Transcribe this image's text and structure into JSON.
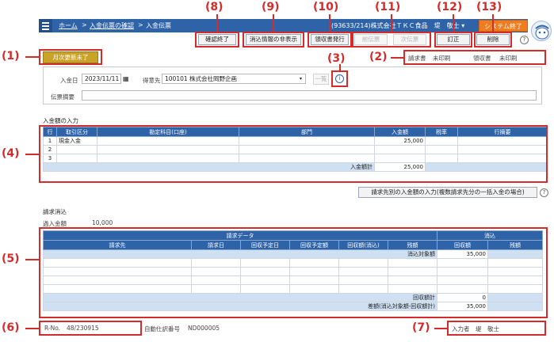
{
  "nav": {
    "breadcrumb_home": "ホーム",
    "breadcrumb_sep1": ">",
    "breadcrumb_confirm": "入金伝票の確認",
    "breadcrumb_sep2": ">",
    "breadcrumb_current": "入金伝票",
    "company": "(93633/214)株式会社ＴＫＣ食品　堤　敬士 ▾",
    "system_exit": "システム終了"
  },
  "toolbar": {
    "confirm_done": "確認終了",
    "hide_reconcile": "消込情報の非表示",
    "issue_receipt": "領収書発行",
    "prev_slip": "前伝票",
    "next_slip": "次伝票",
    "correct": "訂正",
    "delete": "削除"
  },
  "status": {
    "monthly_update": "月次更新未了",
    "invoice_label": "請求書",
    "invoice_status": "未印刷",
    "receipt_label": "領収書",
    "receipt_status": "未印刷"
  },
  "header_form": {
    "date_label": "入金日",
    "date_value": "2023/11/11",
    "customer_label": "得意先",
    "customer_value": "100101 株式会社岡野企画",
    "list_button": "一覧",
    "summary_label": "伝票摘要",
    "summary_value": ""
  },
  "deposit_section": {
    "title": "入金額の入力",
    "columns": [
      "行",
      "取引区分",
      "勘定科目(口座)",
      "部門",
      "入金額",
      "税率",
      "行摘要"
    ],
    "rows": [
      [
        "1",
        "現金入金",
        "",
        "",
        "25,000",
        "",
        ""
      ],
      [
        "2",
        "",
        "",
        "",
        "",
        "",
        ""
      ],
      [
        "3",
        "",
        "",
        "",
        "",
        "",
        ""
      ]
    ],
    "total_label": "入金額計",
    "total_value": "25,000"
  },
  "multi_customer_button": "請求先別の入金額の入力(複数請求先分の一括入金の場合)",
  "reconcile_section": {
    "title": "請求消込",
    "overpay_label": "過入金額",
    "overpay_value": "10,000",
    "group_invoice": "請求データ",
    "group_reconcile": "消込",
    "columns": [
      "請求先",
      "請求日",
      "回収予定日",
      "回収予定額",
      "回収額(消込)",
      "残額",
      "回収額",
      "残額"
    ],
    "target_label": "消込対象額",
    "target_value": "35,000",
    "collected_label": "回収額計",
    "collected_value": "0",
    "diff_label": "差額(消込対象額-回収額計)",
    "diff_value": "35,000"
  },
  "footer": {
    "rno_label": "R-No.",
    "rno_value": "48/230915",
    "auto_label": "自動仕訳番号",
    "auto_value": "ND000005",
    "inputter_label": "入力者",
    "inputter_value": "堤　敬士"
  },
  "callouts": {
    "c1": "(1)",
    "c2": "(2)",
    "c3": "(3)",
    "c4": "(4)",
    "c5": "(5)",
    "c6": "(6)",
    "c7": "(7)",
    "c8": "(8)",
    "c9": "(9)",
    "c10": "(10)",
    "c11": "(11)",
    "c12": "(12)",
    "c13": "(13)"
  },
  "accent_colors": {
    "nav": "#2f63a8",
    "exit": "#ef7d1f",
    "monthly": "#c9a227",
    "callout": "#d62b2b"
  }
}
